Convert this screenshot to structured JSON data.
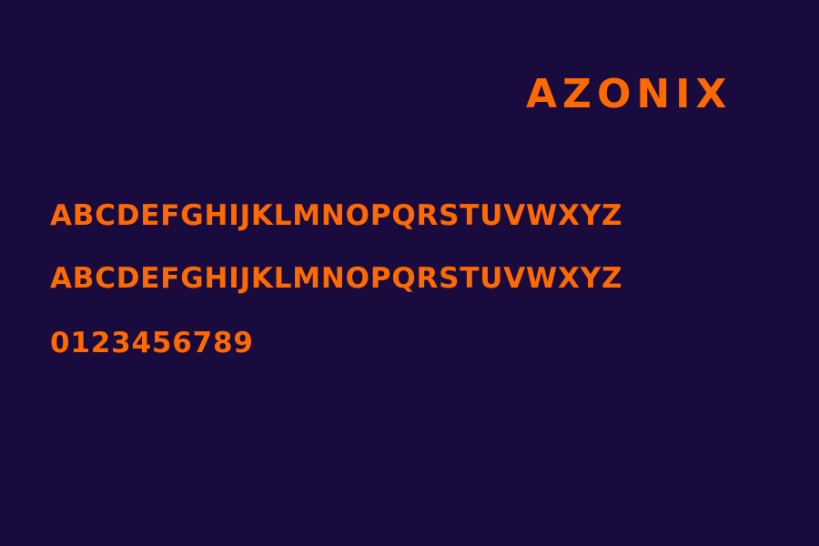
{
  "specimen": {
    "title": "AZONIX",
    "uppercase": "ABCDEFGHIJKLMNOPQRSTUVWXYZ",
    "lowercase": "ABCDEFGHIJKLMNOPQRSTUVWXYZ",
    "digits": "0123456789"
  },
  "colors": {
    "background": "#1a0b3f",
    "text": "#ff6a00"
  }
}
